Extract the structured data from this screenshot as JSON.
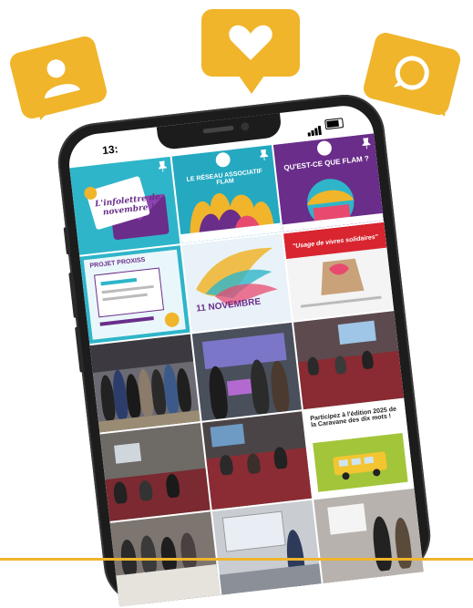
{
  "bubbles": [
    {
      "icon": "user-icon",
      "color": "#f0b52b"
    },
    {
      "icon": "heart-icon",
      "color": "#f0b52b"
    },
    {
      "icon": "comment-icon",
      "color": "#f0b52b"
    }
  ],
  "status_bar": {
    "time": "13:"
  },
  "posts": {
    "p1": {
      "title": "L'infolettre de novembre !"
    },
    "p2": {
      "title": "LE RÉSEAU ASSOCIATIF FLAM"
    },
    "p3": {
      "title": "QU'EST-CE QUE FLAM ?"
    },
    "p4": {
      "title": "PROJET PROXISS"
    },
    "p5": {
      "title": "11 NOVEMBRE"
    },
    "p6": {
      "title": "\"Usage de vivres solidaires\""
    },
    "p10": {
      "title": "Participez à l'édition 2025 de la Caravane des dix mots !"
    }
  },
  "colors": {
    "accent": "#f0b52b",
    "phone": "#1c1c1c",
    "flam_purple": "#6a2d8a"
  }
}
